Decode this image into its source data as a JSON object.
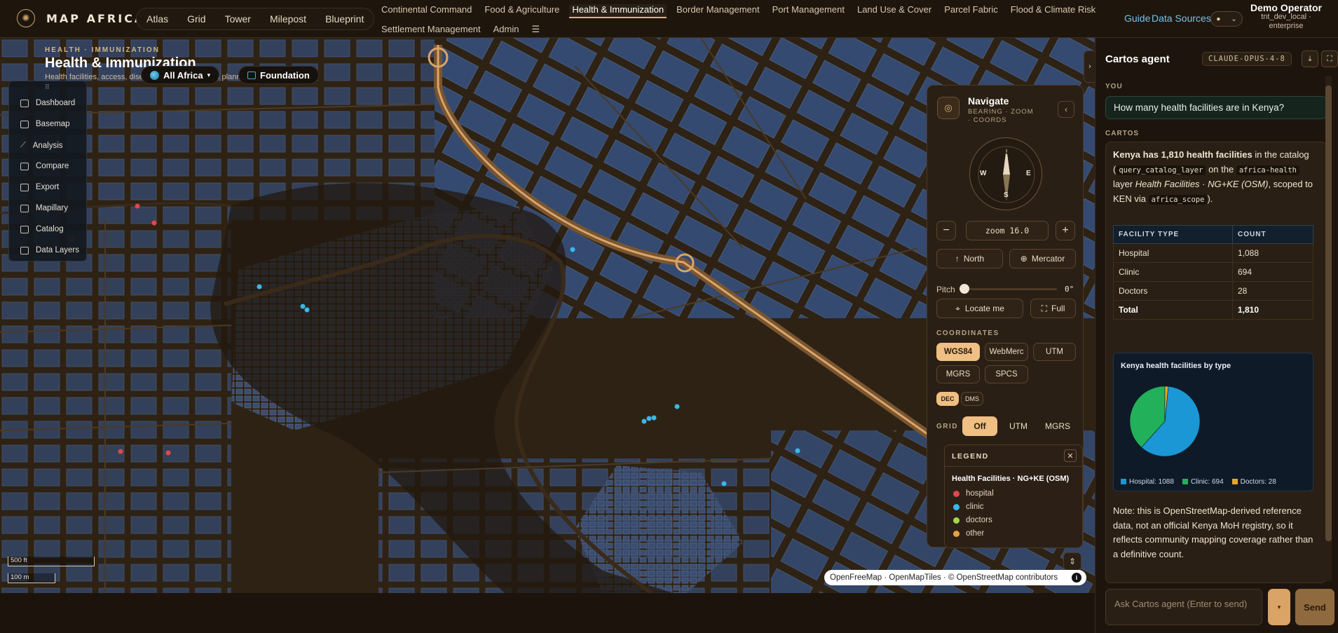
{
  "app": {
    "logo_text": "MAP AFRICA",
    "modes": [
      "Atlas",
      "Grid",
      "Tower",
      "Milepost",
      "Blueprint"
    ],
    "nav_row1": [
      "Continental Command",
      "Food & Agriculture",
      "Health & Immunization",
      "Border Management",
      "Port Management",
      "Land Use & Cover",
      "Parcel Fabric",
      "Flood & Climate Risk"
    ],
    "nav_row2": [
      "Settlement Management",
      "Admin"
    ],
    "active_nav": "Health & Immunization",
    "guide_label": "Guide",
    "data_sources_label": "Data Sources",
    "user_name": "Demo Operator",
    "user_sub1": "tnt_dev_local ·",
    "user_sub2": "enterprise"
  },
  "map": {
    "eyebrow": "HEALTH · IMMUNIZATION",
    "title": "Health & Immunization",
    "subtitle": "Health facilities, access, disease burden, campaign planning and cold-chain",
    "scope_chip": "All Africa",
    "basemap_chip": "Foundation",
    "tools": [
      "Dashboard",
      "Basemap",
      "Analysis",
      "Compare",
      "Export",
      "Mapillary",
      "Catalog",
      "Data Layers"
    ],
    "scale_ft": "500 ft",
    "scale_m": "100 m",
    "attribution": "OpenFreeMap · OpenMapTiles · © OpenStreetMap contributors"
  },
  "navigate": {
    "title": "Navigate",
    "subtitle": "BEARING · ZOOM · COORDS",
    "compass_n": "N",
    "compass_s": "S",
    "compass_e": "E",
    "compass_w": "W",
    "zoom_label": "zoom 16.0",
    "north_btn": "North",
    "projection_btn": "Mercator",
    "pitch_label": "Pitch",
    "pitch_value": "0°",
    "pitch_fraction": 0,
    "locate_btn": "Locate me",
    "full_btn": "Full",
    "coords_label": "COORDINATES",
    "coord_systems": [
      "WGS84",
      "WebMerc",
      "UTM",
      "MGRS",
      "SPCS"
    ],
    "coord_active": "WGS84",
    "format_options": [
      "DEC",
      "DMS"
    ],
    "format_active": "DEC",
    "grid_label": "GRID",
    "grid_options": [
      "Off",
      "UTM",
      "MGRS"
    ],
    "grid_active": "Off"
  },
  "legend": {
    "title": "LEGEND",
    "layer": "Health Facilities · NG+KE (OSM)",
    "items": [
      {
        "label": "hospital",
        "color": "#e0474c"
      },
      {
        "label": "clinic",
        "color": "#3ab7e8"
      },
      {
        "label": "doctors",
        "color": "#a6d64a"
      },
      {
        "label": "other",
        "color": "#e8a040"
      }
    ]
  },
  "agent": {
    "title": "Cartos agent",
    "model": "CLAUDE-OPUS-4-8",
    "you_label": "YOU",
    "question": "How many health facilities are in Kenya?",
    "cartos_label": "CARTOS",
    "answer_bold": "Kenya has 1,810 health facilities",
    "answer_t1": " in the catalog (",
    "answer_code1": "query_catalog_layer",
    "answer_t2": " on the ",
    "answer_code2": "africa-health",
    "answer_t3": " layer ",
    "answer_layer": "Health Facilities · NG+KE (OSM)",
    "answer_t4": ", scoped to KEN via ",
    "answer_code3": "africa_scope",
    "answer_t5": ").",
    "table_headers": [
      "FACILITY TYPE",
      "COUNT"
    ],
    "table_rows": [
      [
        "Hospital",
        "1,088"
      ],
      [
        "Clinic",
        "694"
      ],
      [
        "Doctors",
        "28"
      ]
    ],
    "table_total": [
      "Total",
      "1,810"
    ],
    "note": "Note: this is OpenStreetMap-derived reference data, not an official Kenya MoH registry, so it reflects community mapping coverage rather than a definitive count.",
    "input_placeholder": "Ask Cartos agent (Enter to send)",
    "send_label": "Send"
  },
  "chart_data": {
    "type": "pie",
    "title": "Kenya health facilities by type",
    "categories": [
      "Hospital",
      "Clinic",
      "Doctors"
    ],
    "values": [
      1088,
      694,
      28
    ],
    "legend_labels": [
      "Hospital: 1088",
      "Clinic: 694",
      "Doctors: 28"
    ],
    "colors": [
      "#1a97d4",
      "#22b05a",
      "#e8a52e"
    ],
    "legend_placement": "bottom"
  }
}
